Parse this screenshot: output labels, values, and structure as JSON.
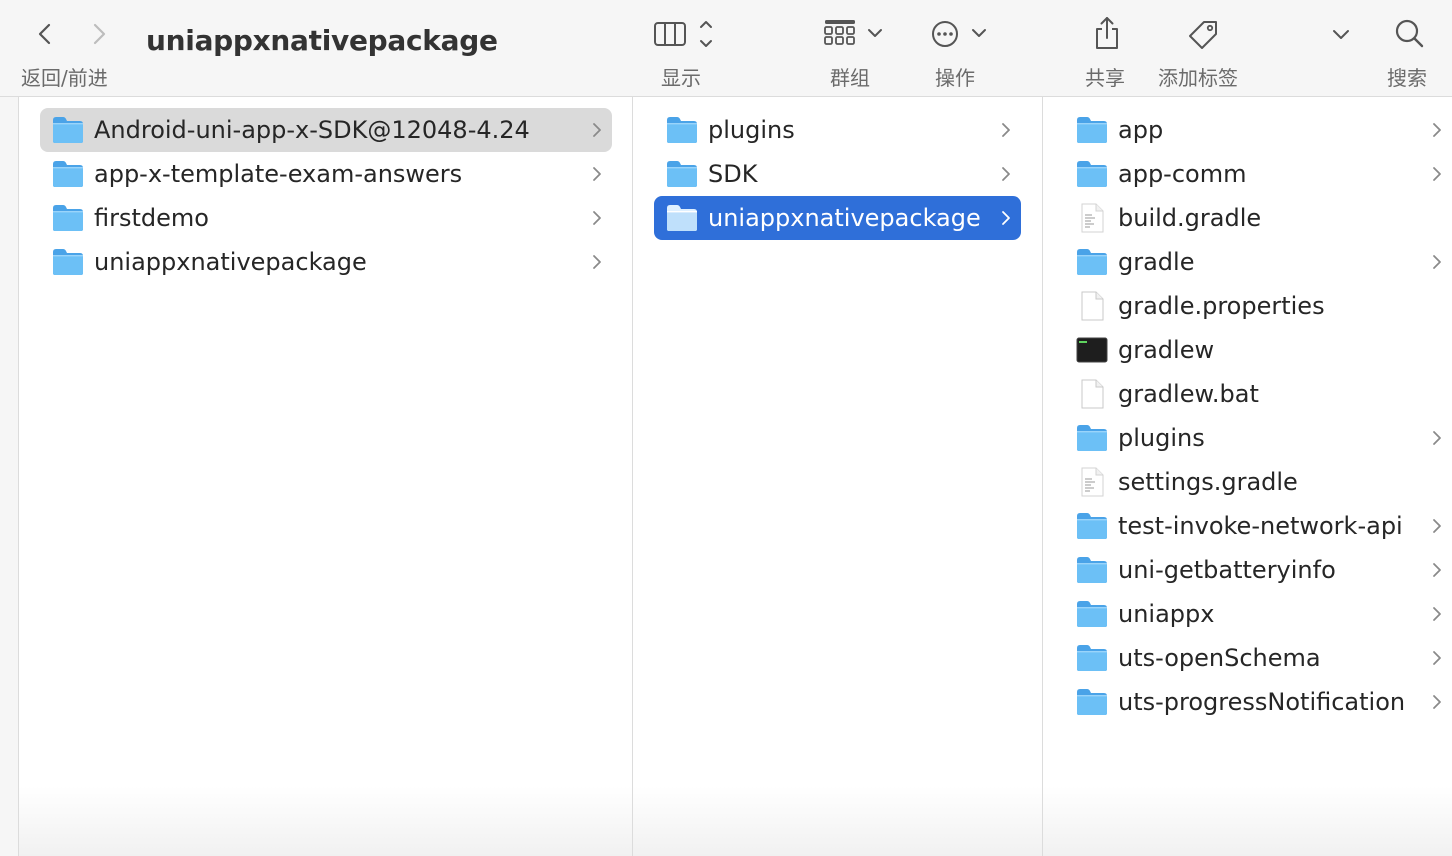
{
  "toolbar": {
    "title": "uniappxnativepackage",
    "nav_label": "返回/前进",
    "display_label": "显示",
    "group_label": "群组",
    "action_label": "操作",
    "share_label": "共享",
    "tag_label": "添加标签",
    "search_label": "搜索"
  },
  "columns": [
    {
      "items": [
        {
          "name": "Android-uni-app-x-SDK@12048-4.24",
          "kind": "folder",
          "selected": "inactive"
        },
        {
          "name": "app-x-template-exam-answers",
          "kind": "folder"
        },
        {
          "name": "firstdemo",
          "kind": "folder"
        },
        {
          "name": "uniappxnativepackage",
          "kind": "folder"
        }
      ]
    },
    {
      "items": [
        {
          "name": "plugins",
          "kind": "folder"
        },
        {
          "name": "SDK",
          "kind": "folder"
        },
        {
          "name": "uniappxnativepackage",
          "kind": "folder",
          "selected": "active"
        }
      ]
    },
    {
      "items": [
        {
          "name": "app",
          "kind": "folder"
        },
        {
          "name": "app-comm",
          "kind": "folder"
        },
        {
          "name": "build.gradle",
          "kind": "text-file"
        },
        {
          "name": "gradle",
          "kind": "folder"
        },
        {
          "name": "gradle.properties",
          "kind": "blank-file"
        },
        {
          "name": "gradlew",
          "kind": "terminal-file"
        },
        {
          "name": "gradlew.bat",
          "kind": "blank-file"
        },
        {
          "name": "plugins",
          "kind": "folder"
        },
        {
          "name": "settings.gradle",
          "kind": "text-file"
        },
        {
          "name": "test-invoke-network-api",
          "kind": "folder"
        },
        {
          "name": "uni-getbatteryinfo",
          "kind": "folder"
        },
        {
          "name": "uniappx",
          "kind": "folder"
        },
        {
          "name": "uts-openSchema",
          "kind": "folder"
        },
        {
          "name": "uts-progressNotification",
          "kind": "folder"
        }
      ]
    }
  ],
  "colors": {
    "selection_active": "#2f6fd9",
    "selection_inactive": "#dadada",
    "folder_blue": "#5fb4f1"
  }
}
